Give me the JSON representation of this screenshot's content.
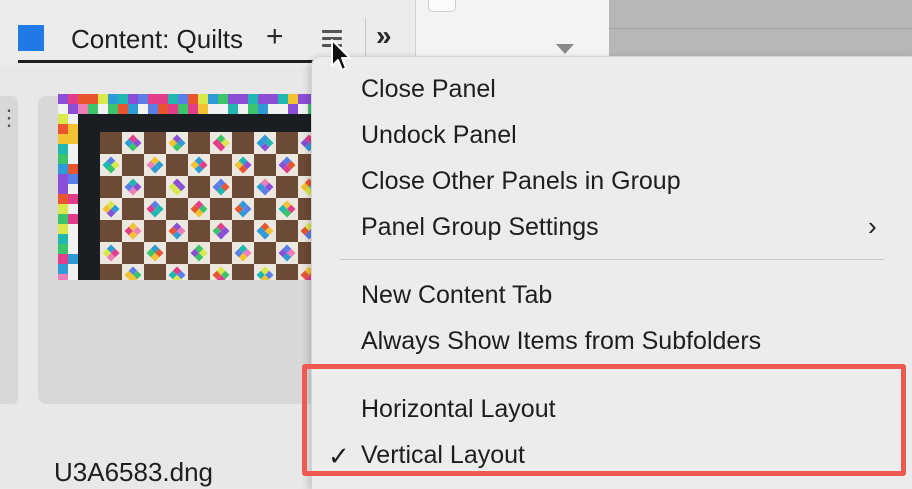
{
  "tab": {
    "title": "Content: Quilts",
    "plus": "+",
    "chevrons": "»",
    "color": "#1f7ae6"
  },
  "icons": {
    "menu": "hamburger-menu-icon",
    "add": "plus-icon",
    "collapse": "double-chevron-icon",
    "settings": "sliders-icon",
    "check": "checkmark-icon",
    "submenu": "chevron-right-icon"
  },
  "content": {
    "filename": "U3A6583.dng"
  },
  "menu": {
    "items": [
      {
        "label": "Close Panel"
      },
      {
        "label": "Undock Panel"
      },
      {
        "label": "Close Other Panels in Group"
      },
      {
        "label": "Panel Group Settings",
        "submenu": "›"
      },
      {
        "label": "New Content Tab"
      },
      {
        "label": "Always Show Items from Subfolders"
      },
      {
        "label": "Horizontal Layout"
      },
      {
        "label": "Vertical Layout",
        "checked": "✓"
      }
    ]
  },
  "highlight_color": "#ef5a4e"
}
